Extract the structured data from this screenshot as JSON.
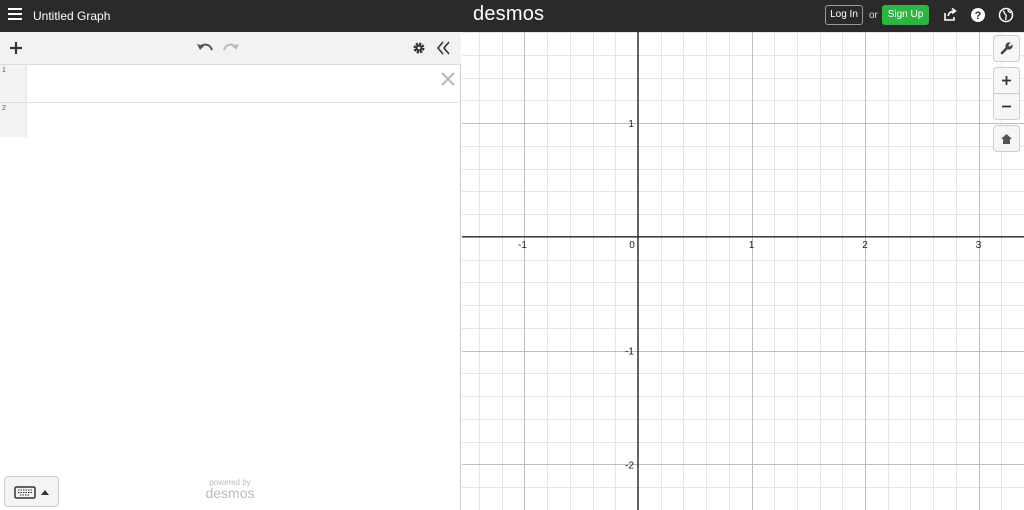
{
  "topbar": {
    "title": "Untitled Graph",
    "brand": "desmos",
    "login_label": "Log In",
    "or_label": "or",
    "signup_label": "Sign Up",
    "background": "#2a2a2a",
    "signup_color": "#2fb443"
  },
  "panel": {
    "expressions": [
      {
        "number": "1",
        "value": ""
      },
      {
        "number": "2",
        "value": ""
      }
    ],
    "powered_by": "powered by",
    "powered_brand": "desmos"
  },
  "graph": {
    "x_range": [
      -1.55,
      3.4
    ],
    "y_range": [
      -2.4,
      1.8
    ],
    "major_step": 1,
    "minor_step": 0.2,
    "x_tick_labels": [
      "-1",
      "0",
      "1",
      "2",
      "3"
    ],
    "y_tick_labels": [
      "1",
      "-1",
      "-2"
    ],
    "grid": true
  },
  "icons": {
    "menu": "hamburger-icon",
    "share": "share-icon",
    "help": "help-icon",
    "language": "globe-icon",
    "add": "plus-icon",
    "undo": "undo-icon",
    "redo": "redo-icon",
    "settings": "gear-icon",
    "collapse": "double-chevron-left-icon",
    "wrench": "wrench-icon",
    "zoom_in": "plus-icon",
    "zoom_out": "minus-icon",
    "home": "home-icon",
    "keyboard": "keyboard-icon"
  }
}
